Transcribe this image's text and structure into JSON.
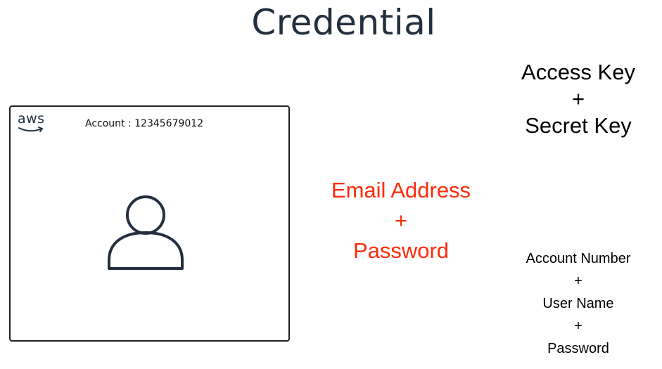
{
  "title": "Credential",
  "card": {
    "logo_text": "aws",
    "account_label": "Account : 12345679012",
    "icon": "user-icon"
  },
  "email_block": {
    "line1": "Email Address",
    "plus": "+",
    "line2": "Password",
    "color": "#ff2a0a"
  },
  "access_block": {
    "line1": "Access Key",
    "plus": "+",
    "line2": "Secret Key"
  },
  "iam_block": {
    "line1": "Account Number",
    "plus1": "+",
    "line2": "User Name",
    "plus2": "+",
    "line3": "Password"
  }
}
